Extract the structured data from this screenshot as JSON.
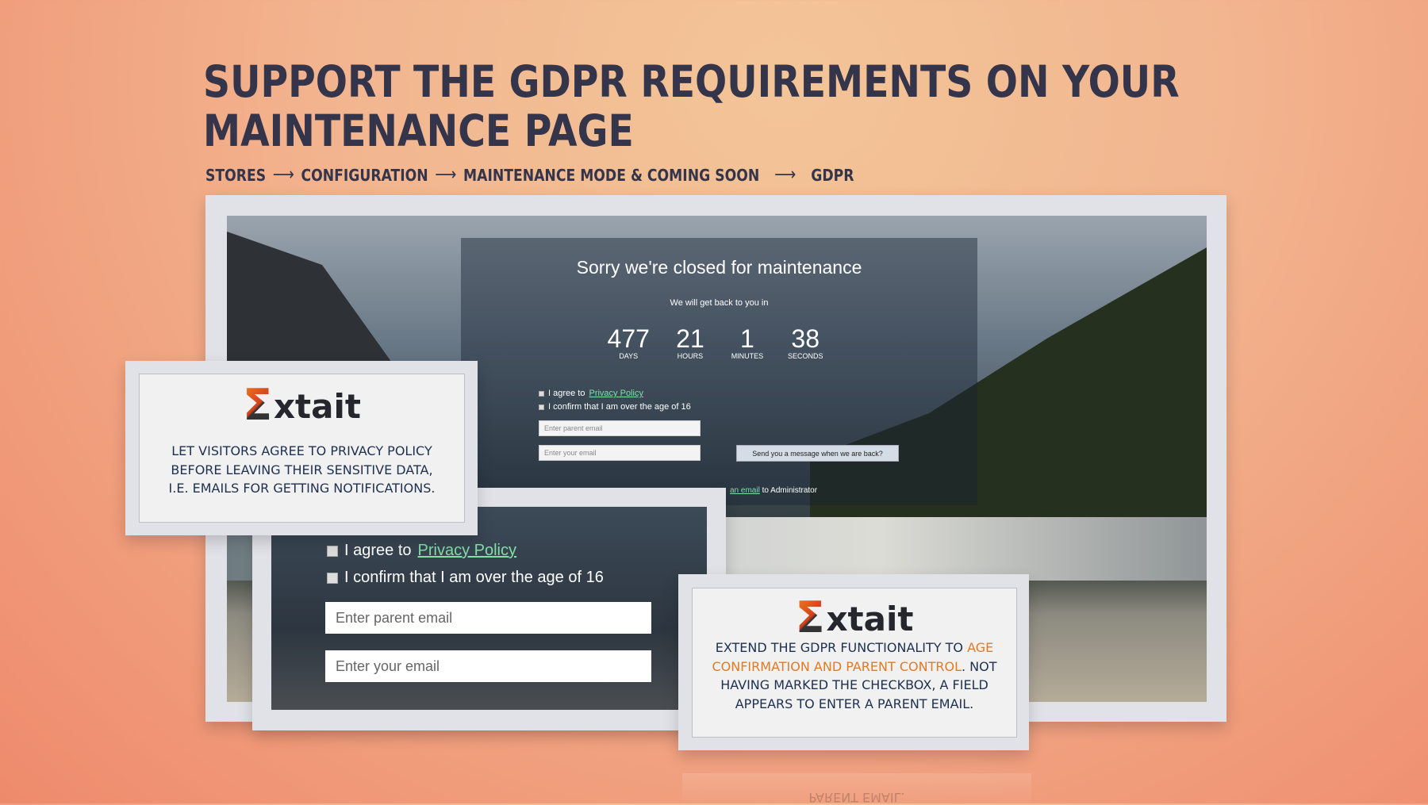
{
  "headline": {
    "line1": "SUPPORT THE GDPR REQUIREMENTS ON YOUR",
    "line2": "MAINTENANCE PAGE"
  },
  "breadcrumb": [
    "STORES",
    "CONFIGURATION",
    "MAINTENANCE MODE & COMING SOON",
    "GDPR"
  ],
  "breadcrumb_separator": "⟶",
  "maintenance": {
    "title": "Sorry we're closed for maintenance",
    "subtitle": "We will get back to you in",
    "countdown": [
      {
        "value": "477",
        "label": "DAYS"
      },
      {
        "value": "21",
        "label": "HOURS"
      },
      {
        "value": "1",
        "label": "MINUTES"
      },
      {
        "value": "38",
        "label": "SECONDS"
      }
    ],
    "agree_prefix": "I agree to",
    "privacy_link": "Privacy Policy",
    "age_confirm": "I confirm that I am over the age of 16",
    "parent_email_placeholder": "Enter parent email",
    "email_placeholder": "Enter your email",
    "notify_button": "Send you a message when we are back?",
    "admin_link": "an email",
    "admin_suffix": " to Administrator"
  },
  "card1": {
    "logo_sigma": "Σ",
    "logo_text": "xtait",
    "text": "LET VISITORS AGREE TO PRIVACY POLICY BEFORE LEAVING THEIR SENSITIVE DATA, I.E. EMAILS FOR GETTING NOTIFICATIONS."
  },
  "card2": {
    "logo_sigma": "Σ",
    "logo_text": "xtait",
    "text_a": "EXTEND THE GDPR FUNCTIONALITY TO ",
    "text_highlight": "AGE CONFIRMATION AND PARENT CONTROL",
    "text_b": ". NOT HAVING MARKED THE CHECKBOX, A FIELD APPEARS TO ENTER A PARENT EMAIL.",
    "reflection": "PARENT EMAIL."
  },
  "colors": {
    "accent": "#e07a25",
    "text": "#34344a",
    "link": "#7fe0a8"
  }
}
